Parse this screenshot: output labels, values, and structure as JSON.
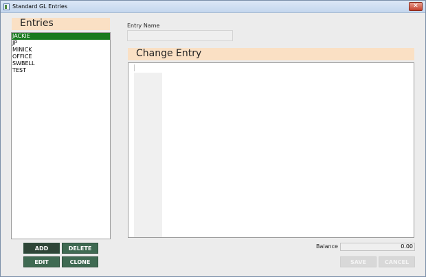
{
  "window": {
    "title": "Standard GL Entries",
    "close_glyph": "✕"
  },
  "entries_panel": {
    "header": "Entries",
    "items": [
      {
        "label": "JACKIE",
        "selected": true
      },
      {
        "label": "JP",
        "selected": false
      },
      {
        "label": "MINICK",
        "selected": false
      },
      {
        "label": "OFFICE",
        "selected": false
      },
      {
        "label": "SWBELL",
        "selected": false
      },
      {
        "label": "TEST",
        "selected": false
      }
    ]
  },
  "buttons": {
    "add": "ADD",
    "delete": "DELETE",
    "edit": "EDIT",
    "clone": "CLONE",
    "save": "SAVE",
    "cancel": "CANCEL"
  },
  "entry_name": {
    "label": "Entry Name",
    "value": ""
  },
  "change_entry": {
    "header": "Change  Entry"
  },
  "balance": {
    "label": "Balance",
    "value": "0.00"
  },
  "colors": {
    "header_bg": "#fae0c4",
    "selected_row": "#197a1e",
    "button_bg": "#3f6a52"
  }
}
